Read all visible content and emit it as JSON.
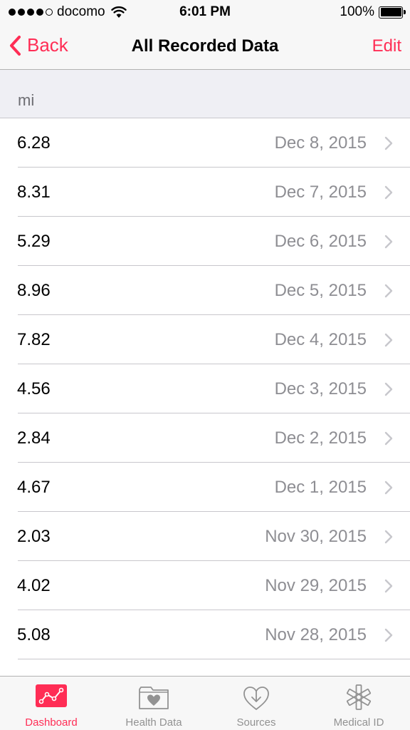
{
  "status_bar": {
    "carrier": "docomo",
    "time": "6:01 PM",
    "battery": "100%",
    "battery_level": 1.0,
    "signal_bars_filled": 4,
    "signal_bars_total": 5
  },
  "nav": {
    "back_label": "Back",
    "title": "All Recorded Data",
    "edit_label": "Edit"
  },
  "section": {
    "unit": "mi"
  },
  "rows": [
    {
      "value": "6.28",
      "date": "Dec 8, 2015"
    },
    {
      "value": "8.31",
      "date": "Dec 7, 2015"
    },
    {
      "value": "5.29",
      "date": "Dec 6, 2015"
    },
    {
      "value": "8.96",
      "date": "Dec 5, 2015"
    },
    {
      "value": "7.82",
      "date": "Dec 4, 2015"
    },
    {
      "value": "4.56",
      "date": "Dec 3, 2015"
    },
    {
      "value": "2.84",
      "date": "Dec 2, 2015"
    },
    {
      "value": "4.67",
      "date": "Dec 1, 2015"
    },
    {
      "value": "2.03",
      "date": "Nov 30, 2015"
    },
    {
      "value": "4.02",
      "date": "Nov 29, 2015"
    },
    {
      "value": "5.08",
      "date": "Nov 28, 2015"
    },
    {
      "value": "",
      "date": ""
    }
  ],
  "tabs": [
    {
      "label": "Dashboard",
      "icon": "dashboard-icon",
      "active": true
    },
    {
      "label": "Health Data",
      "icon": "health-data-icon",
      "active": false
    },
    {
      "label": "Sources",
      "icon": "sources-icon",
      "active": false
    },
    {
      "label": "Medical ID",
      "icon": "medical-id-icon",
      "active": false
    }
  ],
  "colors": {
    "accent": "#ff2d55",
    "secondary_text": "#8e8e93",
    "inactive_tab": "#929292"
  }
}
